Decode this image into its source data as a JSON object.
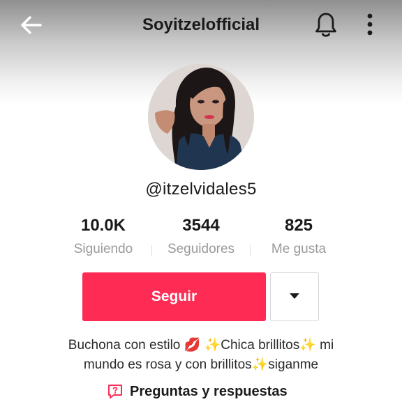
{
  "header": {
    "title": "Soyitzelofficial",
    "back_icon": "arrow-left-icon",
    "bell_icon": "bell-icon",
    "more_icon": "more-vertical-icon"
  },
  "profile": {
    "username": "@itzelvidales5",
    "avatar": "profile-photo"
  },
  "stats": [
    {
      "value": "10.0K",
      "label": "Siguiendo"
    },
    {
      "value": "3544",
      "label": "Seguidores"
    },
    {
      "value": "825",
      "label": "Me gusta"
    }
  ],
  "actions": {
    "follow_label": "Seguir",
    "dropdown_icon": "triangle-down-icon",
    "accent_color": "#fe2c55"
  },
  "bio": {
    "line1": "Buchona con estilo 💋 ✨Chica brillitos✨ mi",
    "line2": "mundo es rosa y con brillitos✨siganme"
  },
  "qa": {
    "label": "Preguntas y respuestas",
    "icon": "question-box-icon"
  }
}
